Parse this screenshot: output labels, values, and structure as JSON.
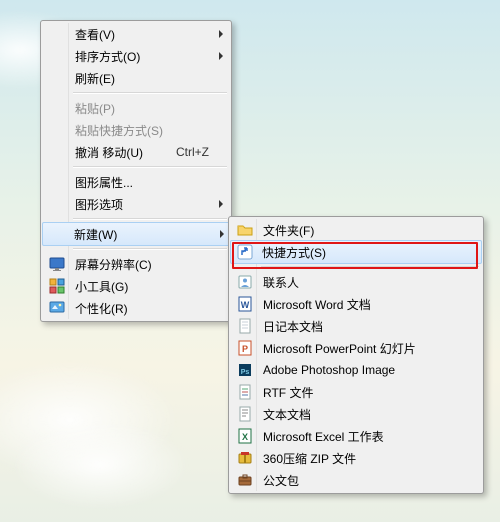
{
  "context_menu": {
    "items": [
      {
        "label": "查看(V)",
        "submenu": true
      },
      {
        "label": "排序方式(O)",
        "submenu": true
      },
      {
        "label": "刷新(E)"
      },
      {
        "sep": true
      },
      {
        "label": "粘贴(P)",
        "disabled": true
      },
      {
        "label": "粘贴快捷方式(S)",
        "disabled": true
      },
      {
        "label": "撤消 移动(U)",
        "shortcut": "Ctrl+Z"
      },
      {
        "sep": true
      },
      {
        "label": "图形属性..."
      },
      {
        "label": "图形选项",
        "submenu": true
      },
      {
        "sep": true
      },
      {
        "label": "新建(W)",
        "submenu": true,
        "highlight": true
      },
      {
        "sep": true
      },
      {
        "label": "屏幕分辨率(C)",
        "icon": "monitor"
      },
      {
        "label": "小工具(G)",
        "icon": "gadgets"
      },
      {
        "label": "个性化(R)",
        "icon": "personalize"
      }
    ]
  },
  "submenu_new": {
    "items": [
      {
        "label": "文件夹(F)",
        "icon": "folder"
      },
      {
        "label": "快捷方式(S)",
        "icon": "shortcut",
        "highlight": true,
        "annotated": true
      },
      {
        "sep": true
      },
      {
        "label": "联系人",
        "icon": "contact"
      },
      {
        "label": "Microsoft Word 文档",
        "icon": "word"
      },
      {
        "label": "日记本文档",
        "icon": "journal"
      },
      {
        "label": "Microsoft PowerPoint 幻灯片",
        "icon": "ppt"
      },
      {
        "label": "Adobe Photoshop Image",
        "icon": "ps"
      },
      {
        "label": "RTF 文件",
        "icon": "rtf"
      },
      {
        "label": "文本文档",
        "icon": "txt"
      },
      {
        "label": "Microsoft Excel 工作表",
        "icon": "excel"
      },
      {
        "label": "360压缩 ZIP 文件",
        "icon": "zip"
      },
      {
        "label": "公文包",
        "icon": "briefcase"
      }
    ]
  },
  "colors": {
    "highlight_border": "#aad0f3",
    "annotation": "#e01616"
  }
}
